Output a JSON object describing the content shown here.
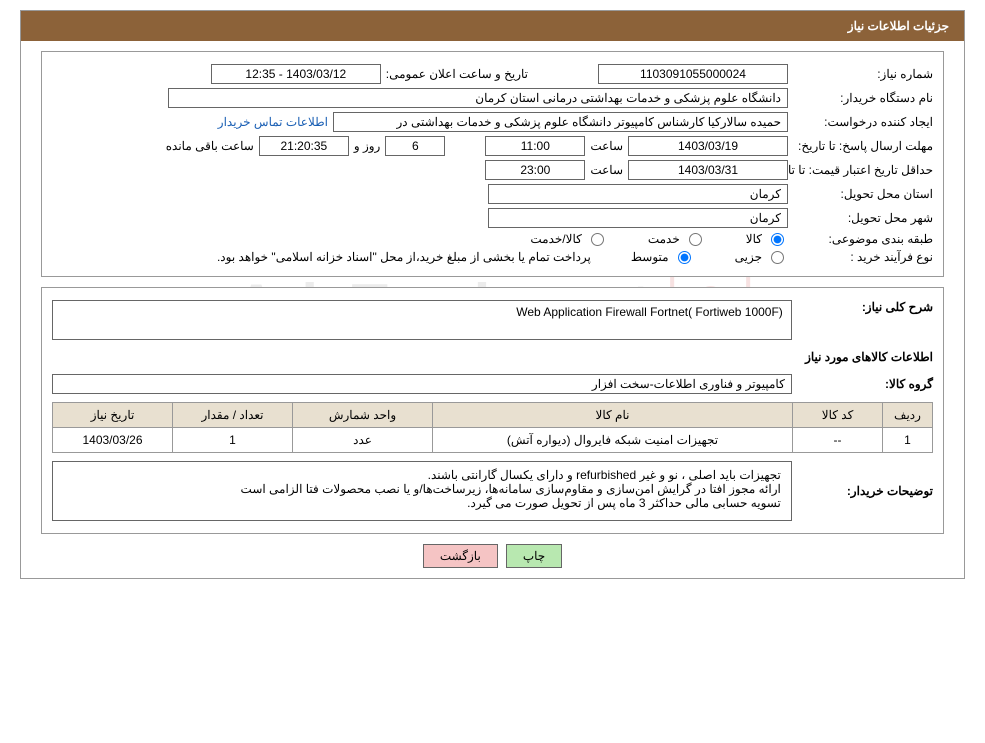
{
  "header": {
    "title": "جزئیات اطلاعات نیاز"
  },
  "fields": {
    "need_no_label": "شماره نیاز:",
    "need_no": "1103091055000024",
    "announce_label": "تاریخ و ساعت اعلان عمومی:",
    "announce_value": "1403/03/12 - 12:35",
    "buyer_label": "نام دستگاه خریدار:",
    "buyer_value": "دانشگاه علوم پزشکی و خدمات بهداشتی درمانی استان کرمان",
    "requester_label": "ایجاد کننده درخواست:",
    "requester_value": "حمیده سالارکیا کارشناس کامپیوتر دانشگاه علوم پزشکی و خدمات بهداشتی در",
    "contact_link": "اطلاعات تماس خریدار",
    "deadline_label": "مهلت ارسال پاسخ: تا تاریخ:",
    "deadline_date": "1403/03/19",
    "time_label": "ساعت",
    "deadline_time": "11:00",
    "days_val": "6",
    "days_text": "روز و",
    "countdown": "21:20:35",
    "remaining": "ساعت باقی مانده",
    "validity_label": "حداقل تاریخ اعتبار قیمت: تا تاریخ:",
    "validity_date": "1403/03/31",
    "validity_time": "23:00",
    "province_label": "استان محل تحویل:",
    "province_value": "کرمان",
    "city_label": "شهر محل تحویل:",
    "city_value": "کرمان",
    "category_label": "طبقه بندی موضوعی:",
    "cat_goods": "کالا",
    "cat_service": "خدمت",
    "cat_both": "کالا/خدمت",
    "process_label": "نوع فرآیند خرید :",
    "proc_partial": "جزیی",
    "proc_medium": "متوسط",
    "process_note": "پرداخت تمام یا بخشی از مبلغ خرید،از محل \"اسناد خزانه اسلامی\" خواهد بود.",
    "summary_label": "شرح کلی نیاز:",
    "summary_value": "Web Application Firewall Fortnet( Fortiweb 1000F)",
    "goods_info_label": "اطلاعات کالاهای مورد نیاز",
    "group_label": "گروه کالا:",
    "group_value": "کامپیوتر و فناوری اطلاعات-سخت افزار",
    "buyer_notes_label": "توضیحات خریدار:",
    "notes_line1": "تجهیزات باید اصلی ، نو و غیر refurbished و دارای یکسال گارانتی  باشند.",
    "notes_line2": "ارائه مجوز افتا در گرایش امن‌سازی و مقاوم‌سازی سامانه‌ها، زیرساخت‌ها/و یا نصب محصولات فتا الزامی است",
    "notes_line3": "تسویه حسابی مالی حداکثر  3 ماه پس از تحویل صورت می گیرد."
  },
  "table": {
    "headers": {
      "row": "ردیف",
      "code": "کد کالا",
      "name": "نام کالا",
      "unit": "واحد شمارش",
      "qty": "تعداد / مقدار",
      "date": "تاریخ نیاز"
    },
    "rows": [
      {
        "row": "1",
        "code": "--",
        "name": "تجهیزات امنیت شبکه فایروال (دیواره آتش)",
        "unit": "عدد",
        "qty": "1",
        "date": "1403/03/26"
      }
    ]
  },
  "buttons": {
    "print": "چاپ",
    "back": "بازگشت"
  },
  "watermark": "AriaTender.net"
}
